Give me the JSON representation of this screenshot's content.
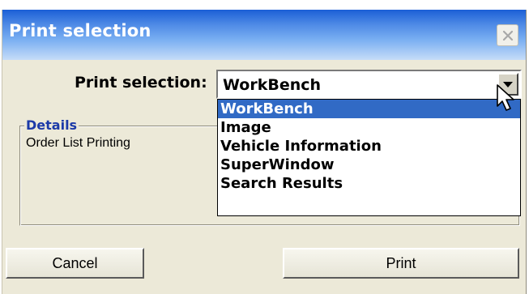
{
  "window": {
    "title": "Print selection",
    "close_icon": "close-icon"
  },
  "selection": {
    "label": "Print selection:",
    "value": "WorkBench",
    "dropdown_icon": "chevron-down-icon",
    "options": [
      "WorkBench",
      "Image",
      "Vehicle Information",
      "SuperWindow",
      "Search Results"
    ],
    "selected_option": "WorkBench"
  },
  "details": {
    "legend": "Details",
    "text": "Order List Printing"
  },
  "buttons": {
    "cancel": "Cancel",
    "print": "Print"
  },
  "colors": {
    "titlebar_start": "#1b5fd6",
    "titlebar_end": "#c6dcf8",
    "dialog_bg": "#ece9d8",
    "selection_highlight": "#316ac5",
    "legend_text": "#1c3aa8"
  }
}
